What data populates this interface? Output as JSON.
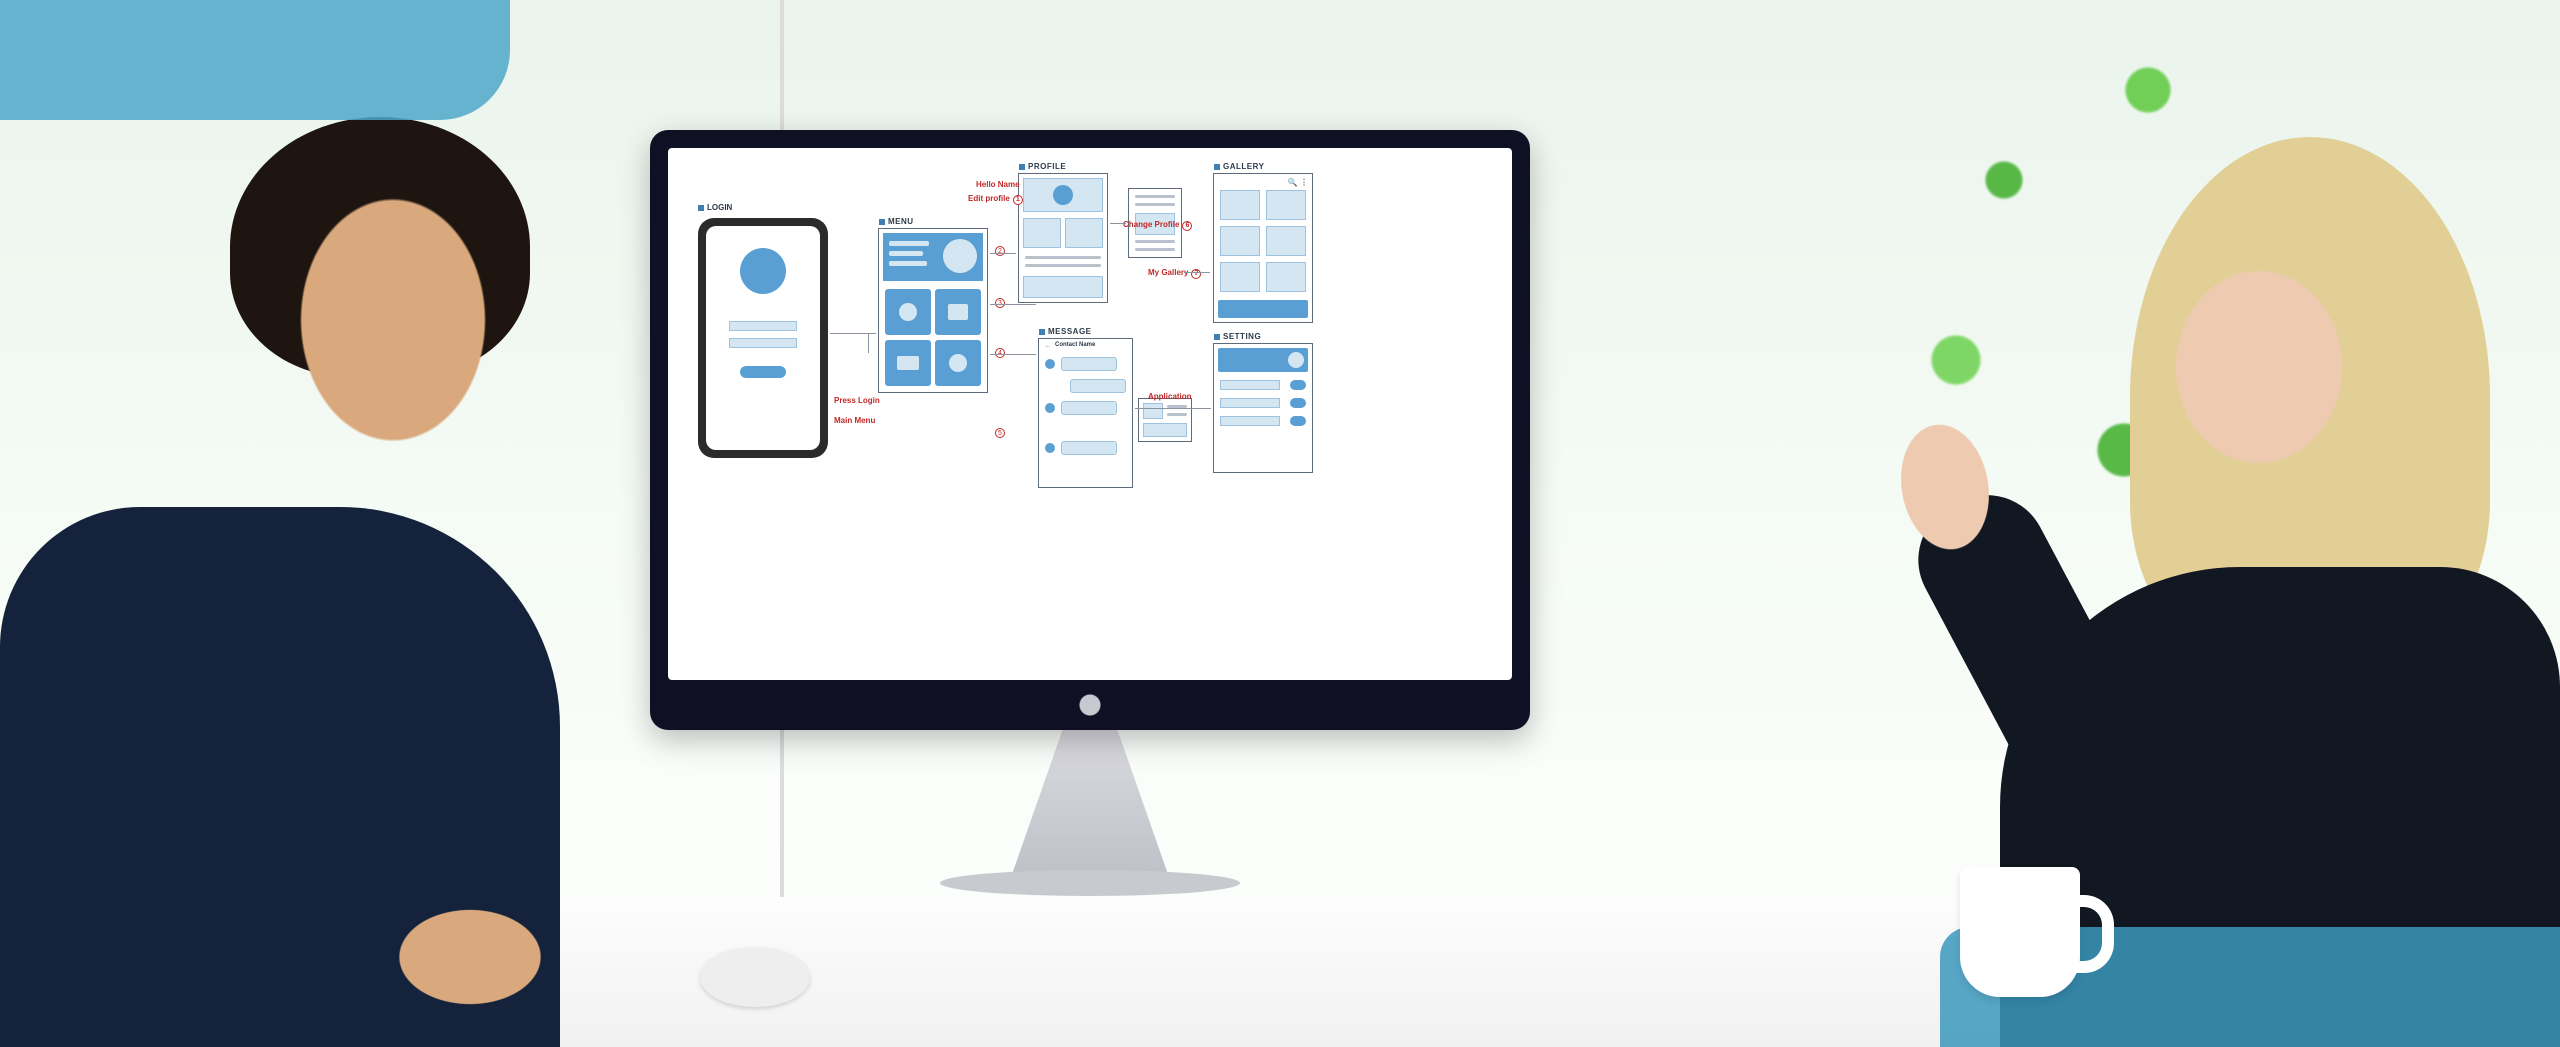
{
  "wireframe": {
    "login": {
      "label": "LOGIN"
    },
    "menu": {
      "label": "MENU"
    },
    "profile": {
      "label": "PROFILE"
    },
    "gallery": {
      "label": "GALLERY"
    },
    "message": {
      "label": "MESSAGE",
      "header": "Contact Name"
    },
    "setting": {
      "label": "SETTING"
    }
  },
  "annotations": {
    "hello": "Hello Name",
    "edit_profile": "Edit profile",
    "press_login": "Press Login",
    "main_menu": "Main Menu",
    "change_profile": "Change Profile",
    "my_gallery": "My Gallery",
    "application": "Application"
  },
  "steps": {
    "s1": "1",
    "s2": "2",
    "s3": "3",
    "s4": "4",
    "s5": "5",
    "s6": "6",
    "s7": "7"
  }
}
